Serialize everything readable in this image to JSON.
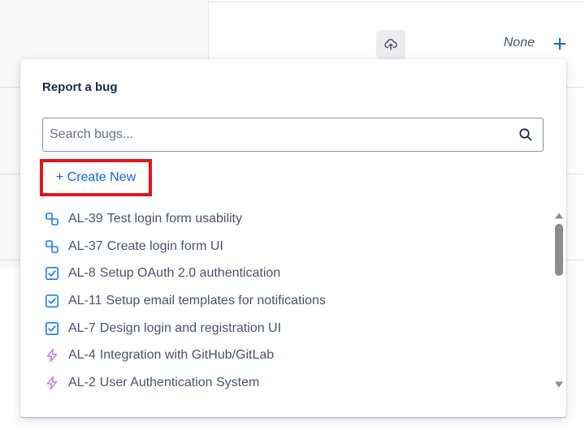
{
  "background": {
    "field_value": "None"
  },
  "popup": {
    "title": "Report a bug",
    "search": {
      "value": "",
      "placeholder": "Search bugs..."
    },
    "create_new_label": "+ Create New",
    "items": [
      {
        "key": "AL-39",
        "summary": "Test login form usability",
        "icon": "subtask-icon",
        "color": "#1d7afc"
      },
      {
        "key": "AL-37",
        "summary": "Create login form UI",
        "icon": "subtask-icon",
        "color": "#1d7afc"
      },
      {
        "key": "AL-8",
        "summary": "Setup OAuth 2.0 authentication",
        "icon": "task-checkbox-icon",
        "color": "#1d7afc"
      },
      {
        "key": "AL-11",
        "summary": "Setup email templates for notifications",
        "icon": "task-checkbox-icon",
        "color": "#1d7afc"
      },
      {
        "key": "AL-7",
        "summary": "Design login and registration UI",
        "icon": "task-checkbox-icon",
        "color": "#1d7afc"
      },
      {
        "key": "AL-4",
        "summary": "Integration with GitHub/GitLab",
        "icon": "epic-lightning-icon",
        "color": "#c97cf4"
      },
      {
        "key": "AL-2",
        "summary": "User Authentication System",
        "icon": "epic-lightning-icon",
        "color": "#c97cf4"
      }
    ]
  },
  "colors": {
    "accent": "#0c66e4",
    "highlight_border": "#e0161b"
  }
}
